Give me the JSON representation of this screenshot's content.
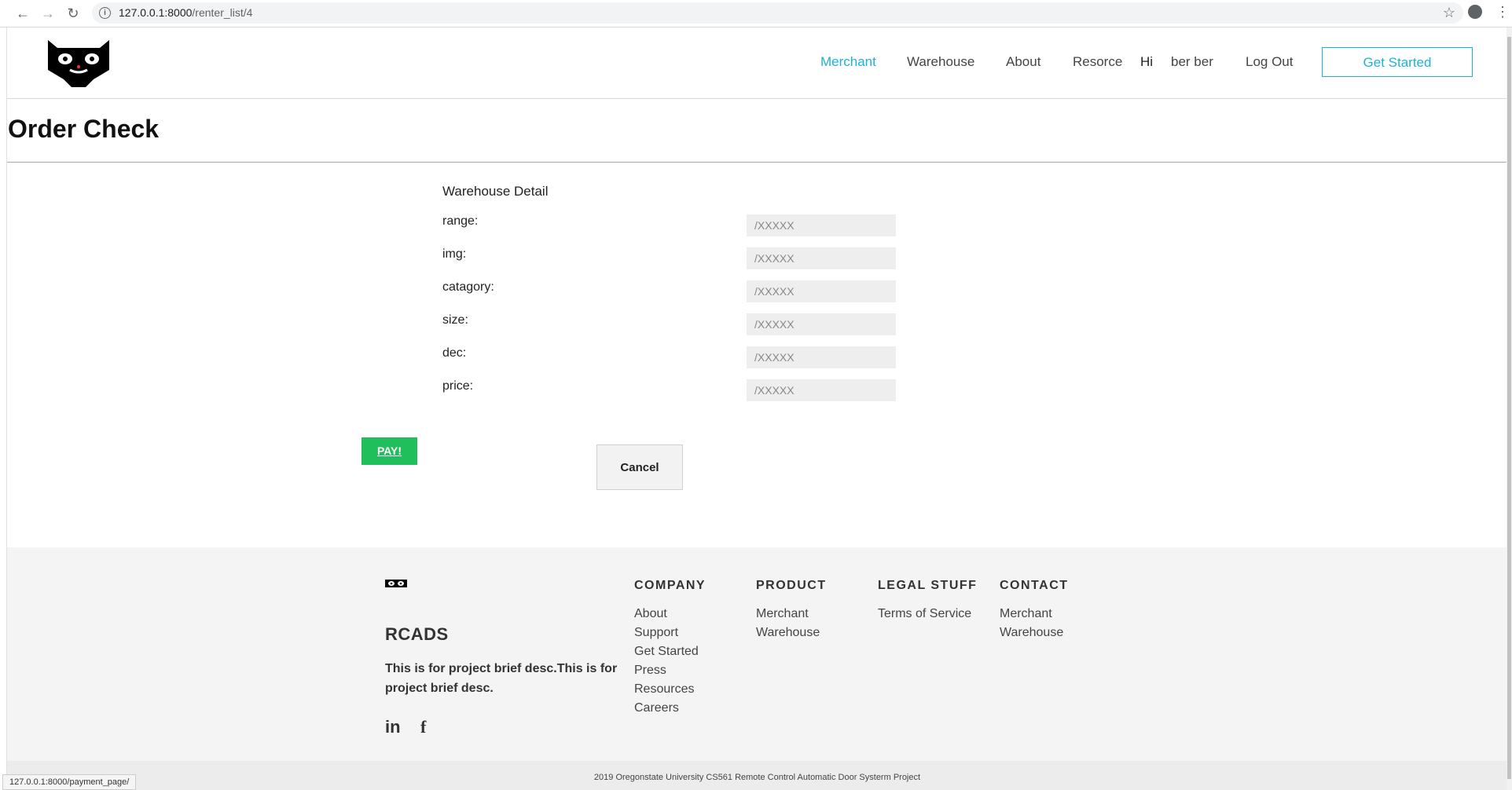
{
  "browser": {
    "url_host": "127.0.0.1:8000",
    "url_path": "/renter_list/4",
    "status_url": "127.0.0.1:8000/payment_page/"
  },
  "nav": {
    "items": [
      "Merchant",
      "Warehouse",
      "About",
      "Resorce",
      "Hi",
      "ber ber",
      "Log Out"
    ],
    "cta": "Get Started",
    "active_color": "#1fb1d8"
  },
  "page": {
    "title": "Order Check"
  },
  "form": {
    "heading": "Warehouse Detail",
    "fields": [
      {
        "label": "range:",
        "placeholder": "/XXXXX"
      },
      {
        "label": "img:",
        "placeholder": "/XXXXX"
      },
      {
        "label": "catagory:",
        "placeholder": "/XXXXX"
      },
      {
        "label": "size:",
        "placeholder": "/XXXXX"
      },
      {
        "label": "dec:",
        "placeholder": "/XXXXX"
      },
      {
        "label": "price:",
        "placeholder": "/XXXXX"
      }
    ],
    "pay_label": "PAY!",
    "cancel_label": "Cancel",
    "pay_color": "#21bf5b"
  },
  "footer": {
    "brand": "RCADS",
    "description": "This is for project brief desc.This is for project brief desc.",
    "social": [
      "in",
      "f"
    ],
    "columns": [
      {
        "title": "COMPANY",
        "links": [
          "About",
          "Support",
          "Get Started",
          "Press",
          "Resources",
          "Careers"
        ]
      },
      {
        "title": "PRODUCT",
        "links": [
          "Merchant",
          "Warehouse"
        ]
      },
      {
        "title": "LEGAL STUFF",
        "links": [
          "Terms of Service"
        ]
      },
      {
        "title": "CONTACT",
        "links": [
          "Merchant",
          "Warehouse"
        ]
      }
    ],
    "copyright": "2019 Oregonstate University CS561 Remote Control Automatic Door Systerm Project"
  }
}
